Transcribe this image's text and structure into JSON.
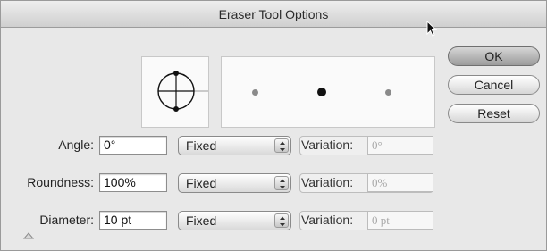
{
  "window": {
    "title": "Eraser Tool Options"
  },
  "buttons": {
    "ok": "OK",
    "cancel": "Cancel",
    "reset": "Reset"
  },
  "rows": [
    {
      "label": "Angle:",
      "value": "0°",
      "mode": "Fixed",
      "variation_label": "Variation:",
      "variation_value": "0°"
    },
    {
      "label": "Roundness:",
      "value": "100%",
      "mode": "Fixed",
      "variation_label": "Variation:",
      "variation_value": "0%"
    },
    {
      "label": "Diameter:",
      "value": "10 pt",
      "mode": "Fixed",
      "variation_label": "Variation:",
      "variation_value": "0 pt"
    }
  ],
  "icons": {
    "brush_shape": "angle-roundness-preview-icon",
    "slider_marker": "triangle-marker-icon",
    "cursor": "arrow-cursor-icon"
  },
  "colors": {
    "default_button": "#a9a9a9",
    "dialog_bg": "#e8e8e8",
    "preview_dots": "#111111"
  }
}
